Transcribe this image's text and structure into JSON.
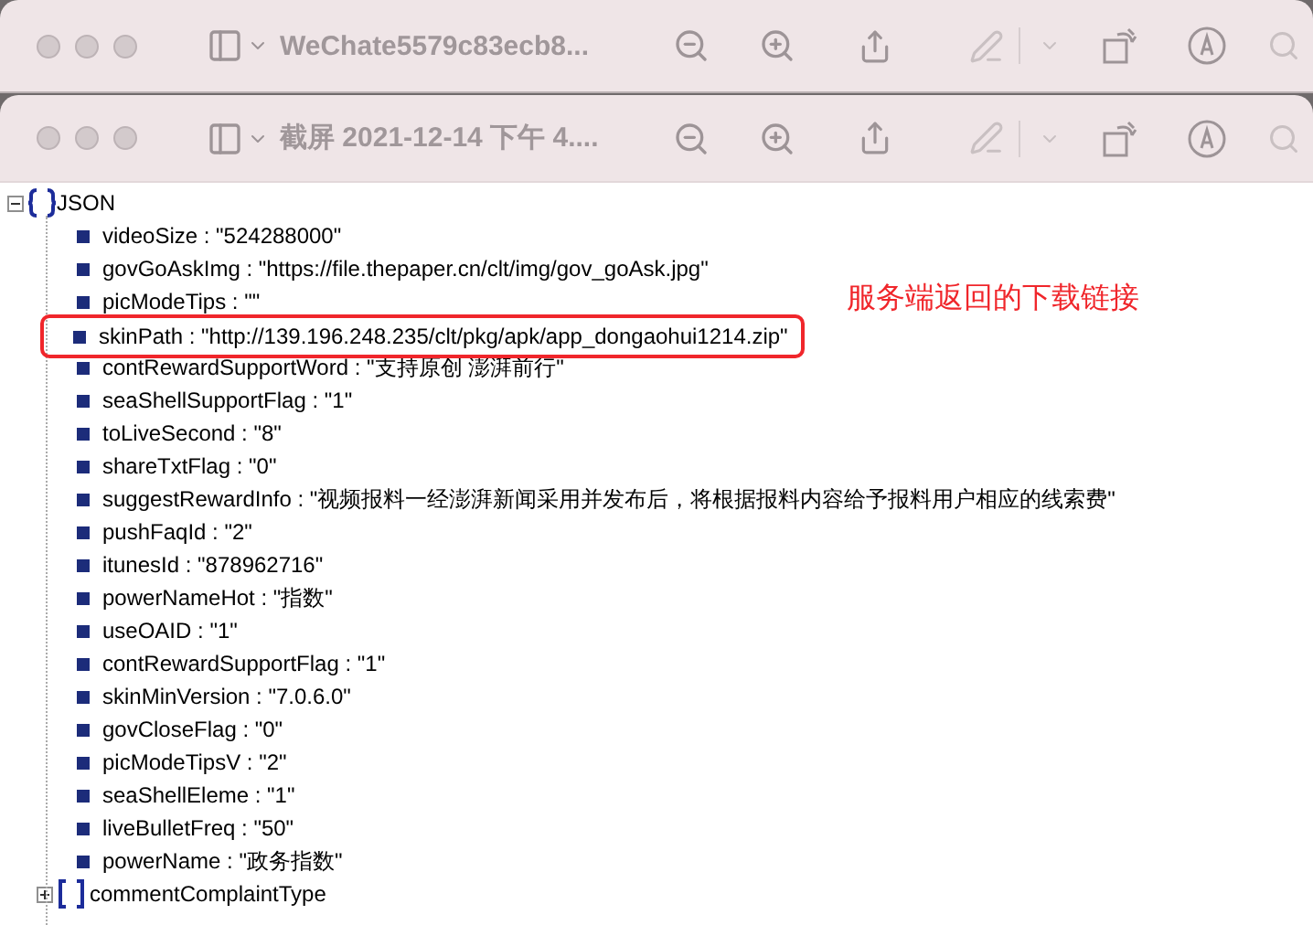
{
  "windows": [
    {
      "title": "WeChate5579c83ecb8...",
      "front": false
    },
    {
      "title": "截屏 2021-12-14 下午 4....",
      "front": true
    }
  ],
  "tree": {
    "label": "JSON",
    "kind": "object",
    "expanded": true,
    "children": [
      {
        "kind": "value",
        "text": "videoSize : \"524288000\"",
        "highlighted": false
      },
      {
        "kind": "value",
        "text": "govGoAskImg : \"https://file.thepaper.cn/clt/img/gov_goAsk.jpg\"",
        "highlighted": false
      },
      {
        "kind": "value",
        "text": "picModeTips : \"\"",
        "highlighted": false
      },
      {
        "kind": "value",
        "text": "skinPath : \"http://139.196.248.235/clt/pkg/apk/app_dongaohui1214.zip\"",
        "highlighted": true
      },
      {
        "kind": "value",
        "text": "contRewardSupportWord : \"支持原创 澎湃前行\"",
        "highlighted": false
      },
      {
        "kind": "value",
        "text": "seaShellSupportFlag : \"1\"",
        "highlighted": false
      },
      {
        "kind": "value",
        "text": "toLiveSecond : \"8\"",
        "highlighted": false
      },
      {
        "kind": "value",
        "text": "shareTxtFlag : \"0\"",
        "highlighted": false
      },
      {
        "kind": "value",
        "text": "suggestRewardInfo : \"视频报料一经澎湃新闻采用并发布后，将根据报料内容给予报料用户相应的线索费\"",
        "highlighted": false
      },
      {
        "kind": "value",
        "text": "pushFaqId : \"2\"",
        "highlighted": false
      },
      {
        "kind": "value",
        "text": "itunesId : \"878962716\"",
        "highlighted": false
      },
      {
        "kind": "value",
        "text": "powerNameHot : \"指数\"",
        "highlighted": false
      },
      {
        "kind": "value",
        "text": "useOAID : \"1\"",
        "highlighted": false
      },
      {
        "kind": "value",
        "text": "contRewardSupportFlag : \"1\"",
        "highlighted": false
      },
      {
        "kind": "value",
        "text": "skinMinVersion : \"7.0.6.0\"",
        "highlighted": false
      },
      {
        "kind": "value",
        "text": "govCloseFlag : \"0\"",
        "highlighted": false
      },
      {
        "kind": "value",
        "text": "picModeTipsV : \"2\"",
        "highlighted": false
      },
      {
        "kind": "value",
        "text": "seaShellEleme : \"1\"",
        "highlighted": false
      },
      {
        "kind": "value",
        "text": "liveBulletFreq : \"50\"",
        "highlighted": false
      },
      {
        "kind": "value",
        "text": "powerName : \"政务指数\"",
        "highlighted": false
      },
      {
        "kind": "array",
        "text": "commentComplaintType",
        "expanded": false,
        "highlighted": false
      }
    ]
  },
  "annotation": "服务端返回的下载链接"
}
